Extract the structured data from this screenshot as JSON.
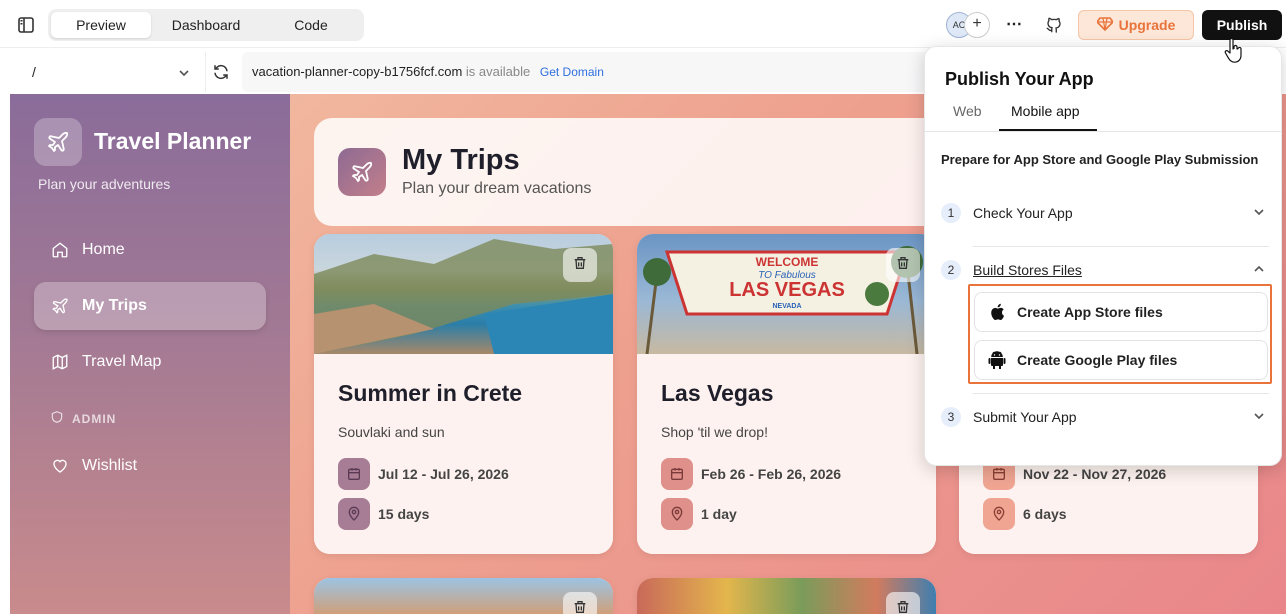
{
  "toolbar": {
    "tabs": [
      {
        "label": "Preview"
      },
      {
        "label": "Dashboard"
      },
      {
        "label": "Code"
      }
    ],
    "avatar_initials": "AC",
    "avatar_add": "+",
    "more": "⋯",
    "upgrade_label": "Upgrade",
    "publish_label": "Publish"
  },
  "urlbar": {
    "route": "/",
    "domain": "vacation-planner-copy-b1756fcf.com",
    "availability": "is available",
    "get_domain": "Get Domain"
  },
  "app": {
    "sidebar": {
      "title": "Travel Planner",
      "subtitle": "Plan your adventures",
      "items": [
        {
          "label": "Home"
        },
        {
          "label": "My Trips"
        },
        {
          "label": "Travel Map"
        }
      ],
      "admin_label": "ADMIN",
      "admin_items": [
        {
          "label": "Wishlist"
        }
      ]
    },
    "header": {
      "title": "My Trips",
      "subtitle": "Plan your dream vacations"
    },
    "trips": [
      {
        "title": "Summer in Crete",
        "desc": "Souvlaki and sun",
        "dates": "Jul 12 - Jul 26, 2026",
        "duration": "15 days"
      },
      {
        "title": "Las Vegas",
        "desc": "Shop 'til we drop!",
        "dates": "Feb 26 - Feb 26, 2026",
        "duration": "1 day"
      },
      {
        "title": "",
        "desc": "",
        "dates": "Nov 22 - Nov 27, 2026",
        "duration": "6 days"
      }
    ],
    "vegas_sign": {
      "welcome": "WELCOME",
      "to_fabulous": "TO Fabulous",
      "las_vegas": "LAS VEGAS",
      "nevada": "NEVADA"
    }
  },
  "publish_panel": {
    "title": "Publish Your App",
    "tabs": [
      {
        "label": "Web"
      },
      {
        "label": "Mobile app"
      }
    ],
    "intro": "Prepare for App Store and Google Play Submission",
    "steps": [
      {
        "num": "1",
        "label": "Check Your App"
      },
      {
        "num": "2",
        "label": "Build Stores Files"
      },
      {
        "num": "3",
        "label": "Submit Your App"
      }
    ],
    "buttons": [
      {
        "label": "Create App Store files"
      },
      {
        "label": "Create Google Play files"
      }
    ]
  },
  "colors": {
    "accent": "#e8743b",
    "publish": "#111111",
    "link": "#2f6fde",
    "highlight": "#e8743b"
  }
}
